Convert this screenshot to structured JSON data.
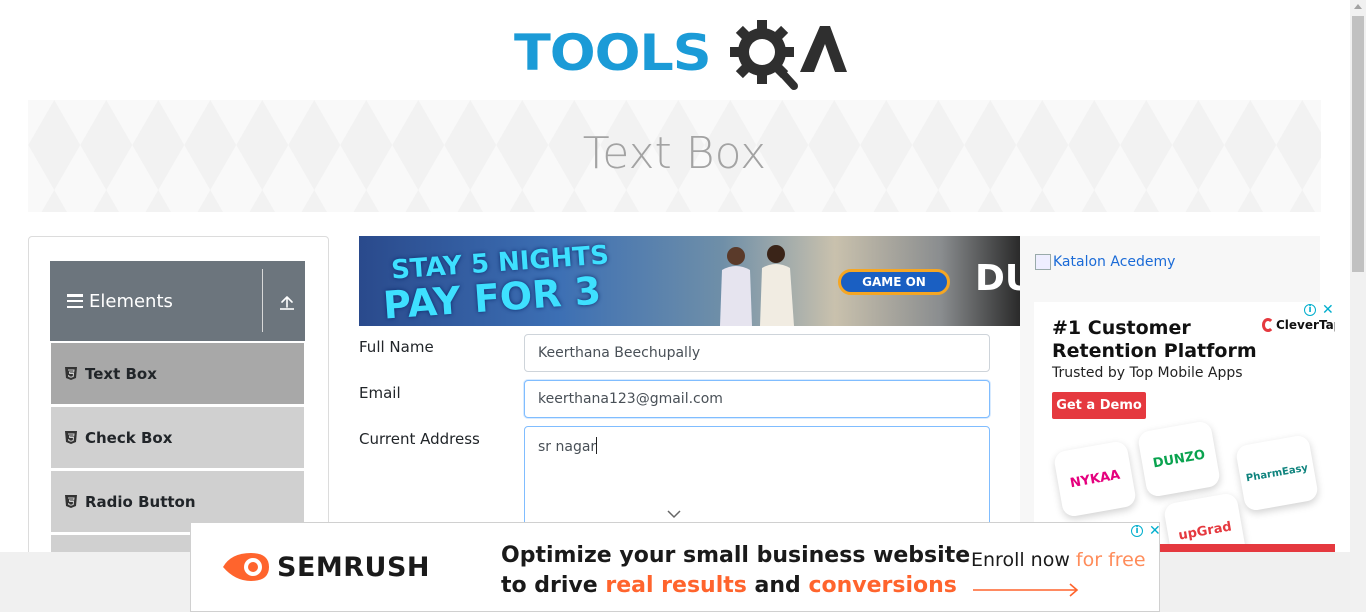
{
  "header": {
    "logo_text": "TOOLS",
    "logo_suffix": "QA"
  },
  "banner": {
    "title": "Text Box"
  },
  "sidebar": {
    "group_title": "Elements",
    "items": [
      {
        "label": "Text Box",
        "active": true
      },
      {
        "label": "Check Box",
        "active": false
      },
      {
        "label": "Radio Button",
        "active": false
      }
    ]
  },
  "form": {
    "full_name_label": "Full Name",
    "full_name_value": "Keerthana Beechupally",
    "email_label": "Email",
    "email_value": "keerthana123@gmail.com",
    "address_label": "Current Address",
    "address_value": "sr nagar"
  },
  "top_ad": {
    "line1": "STAY 5 NIGHTS",
    "line2": "PAY FOR 3",
    "button": "GAME ON",
    "brand": "DU"
  },
  "right_ads": {
    "katalon_alt": "Katalon Acedemy",
    "clevertap": {
      "headline": "#1 Customer Retention Platform",
      "sub": "Trusted by Top Mobile Apps",
      "cta": "Get a Demo",
      "logo": "CleverTap",
      "tiles": [
        "NYKAA",
        "DUNZO",
        "PharmEasy",
        "upGrad"
      ]
    }
  },
  "bottom_ad": {
    "brand": "SEMRUSH",
    "headline_1": "Optimize your small business website",
    "headline_2_a": "to drive ",
    "headline_2_hl1": "real results",
    "headline_2_b": " and ",
    "headline_2_hl2": "conversions",
    "enroll_a": "Enroll now ",
    "enroll_hl": "for free"
  },
  "colors": {
    "brand_blue": "#1b9bd7",
    "sidebar_header": "#6c757d",
    "active_item": "#a8a8a8",
    "focus_border": "#80bdff",
    "accent_red": "#e5393f",
    "semrush_orange": "#ff642d"
  }
}
